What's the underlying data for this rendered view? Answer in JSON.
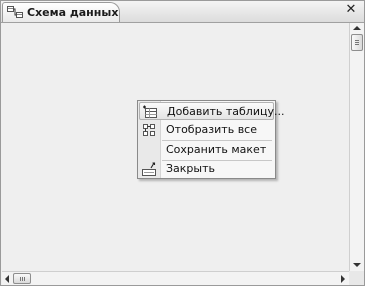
{
  "window": {
    "tab_title": "Схема данных",
    "close_glyph": "✕",
    "tab_icon": "relationships-icon"
  },
  "context_menu": {
    "items": [
      {
        "label": "Добавить таблицу...",
        "icon": "add-table-icon",
        "highlighted": true
      },
      {
        "label": "Отобразить все",
        "icon": "show-all-icon",
        "highlighted": false
      },
      {
        "label": "Сохранить макет",
        "icon": null,
        "highlighted": false
      },
      {
        "label": "Закрыть",
        "icon": "close-diagram-icon",
        "highlighted": false
      }
    ]
  },
  "colors": {
    "canvas": "#efefef",
    "menu_background": "#f7f7f7",
    "menu_border": "#8a8a8a"
  }
}
